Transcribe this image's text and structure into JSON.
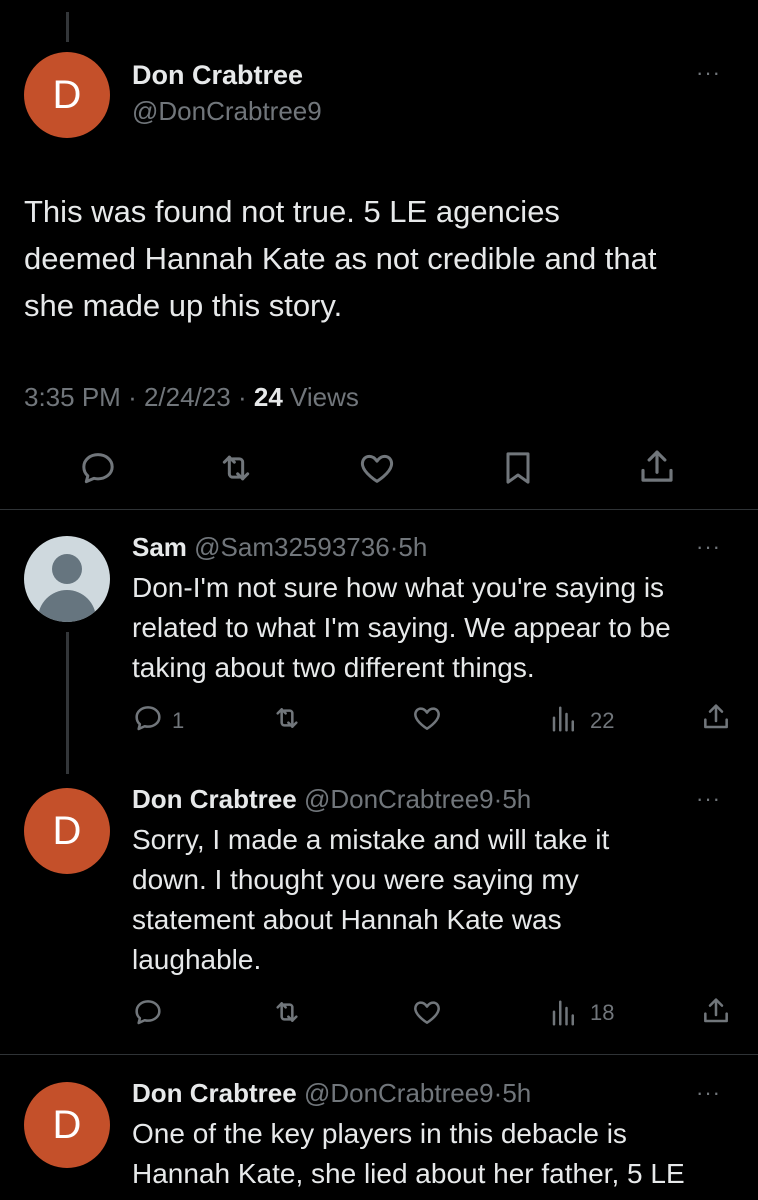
{
  "main_tweet": {
    "avatar_letter": "D",
    "display_name": "Don Crabtree",
    "handle": "@DonCrabtree9",
    "more": "···",
    "text_lines": [
      "This was found not true. 5 LE agencies",
      "deemed Hannah Kate as not credible and that",
      "she made up this story."
    ],
    "time": "3:35 PM",
    "sep1": "·",
    "date": "2/24/23",
    "sep2": "·",
    "views_count": "24",
    "views_label": "Views"
  },
  "replies": [
    {
      "display_name": "Sam",
      "handle": "@Sam32593736",
      "dot": "·",
      "age": "5h",
      "more": "···",
      "text_lines": [
        "Don-I'm not sure how what you're saying is",
        "related to what I'm saying. We appear to be",
        "taking about two different things."
      ],
      "reply_count": "1",
      "views": "22"
    },
    {
      "avatar_letter": "D",
      "display_name": "Don Crabtree",
      "handle": "@DonCrabtree9",
      "dot": "·",
      "age": "5h",
      "more": "···",
      "text_lines": [
        "Sorry, I made a mistake and will take it",
        "down. I thought you were saying my",
        "statement about Hannah Kate was",
        "laughable."
      ],
      "views": "18"
    },
    {
      "avatar_letter": "D",
      "display_name": "Don Crabtree",
      "handle": "@DonCrabtree9",
      "dot": "·",
      "age": "5h",
      "more": "···",
      "text_lines": [
        "One of the key players in this debacle is",
        "Hannah Kate, she lied about her father, 5 LE"
      ]
    }
  ],
  "colors": {
    "background": "#000000",
    "text": "#e7e9ea",
    "muted": "#71767b",
    "avatar_d": "#c4502a",
    "divider": "#2f3336"
  },
  "icons": {
    "reply": "reply-icon",
    "retweet": "retweet-icon",
    "like": "like-icon",
    "bookmark": "bookmark-icon",
    "share": "share-icon",
    "views": "views-icon",
    "more": "more-icon"
  }
}
